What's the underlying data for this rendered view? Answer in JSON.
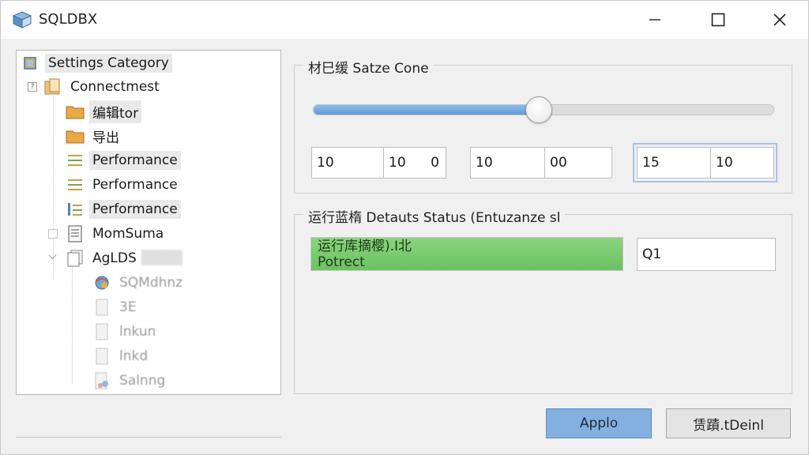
{
  "window": {
    "title": "SQLDBX"
  },
  "tree": {
    "items": [
      {
        "label": "Settings Category",
        "icon": "settings-db-icon"
      },
      {
        "label": "Connectmest",
        "icon": "folder-clipboard-icon"
      },
      {
        "label": "编辑tor",
        "icon": "folder-icon"
      },
      {
        "label": "导出",
        "icon": "folder-icon"
      },
      {
        "label": "Performance",
        "icon": "list-lines-icon"
      },
      {
        "label": "Performance",
        "icon": "list-lines-icon"
      },
      {
        "label": "Performance",
        "icon": "chart-list-icon"
      },
      {
        "label": "MomSuma",
        "icon": "document-icon"
      },
      {
        "label": "AgLDS",
        "icon": "document-stack-icon"
      },
      {
        "label": "SQMdhnz",
        "icon": "globe-icon"
      },
      {
        "label": "3E",
        "icon": "file-icon"
      },
      {
        "label": "lnkun",
        "icon": "file-icon"
      },
      {
        "label": "lnkd",
        "icon": "file-icon"
      },
      {
        "label": "Salnng",
        "icon": "file-color-icon"
      }
    ]
  },
  "group1": {
    "title": "材巳缓 Satze Cone",
    "slider_value_fraction": 0.49,
    "fields": [
      {
        "value": "10",
        "extra": ""
      },
      {
        "value": "10",
        "extra": "0"
      },
      {
        "value": "10",
        "extra": ""
      },
      {
        "value": "00",
        "extra": ""
      },
      {
        "value": "15",
        "extra": ""
      },
      {
        "value": "10",
        "extra": ""
      }
    ]
  },
  "group2": {
    "title": "运行蓝楕 Detauts Status (Entuzanze sl",
    "progress_line1": "运行库摘樱).Ⅰ北",
    "progress_line2": "Potrect",
    "progress_fraction": 1.0,
    "side_field": "Q1"
  },
  "buttons": {
    "apply_label": "Applo",
    "cancel_label": "赁蹟.tDeinl"
  },
  "colors": {
    "accent": "#84b0e0",
    "progress": "#6cc161",
    "slider": "#5f9bd6"
  }
}
